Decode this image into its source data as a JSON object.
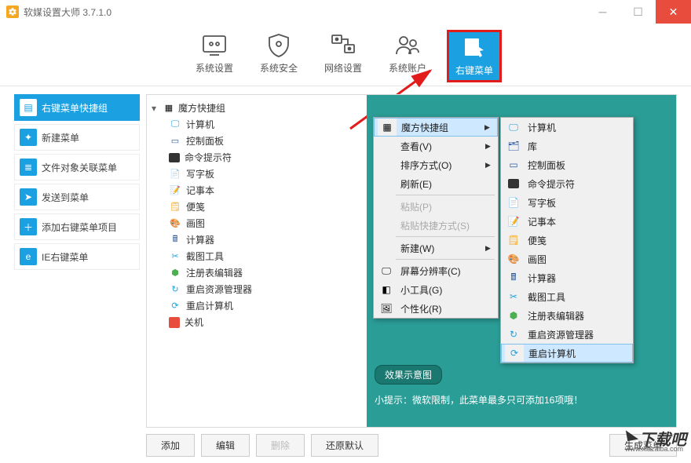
{
  "app": {
    "title": "软媒设置大师 3.7.1.0"
  },
  "tabs": {
    "items": [
      {
        "label": "系统设置"
      },
      {
        "label": "系统安全"
      },
      {
        "label": "网络设置"
      },
      {
        "label": "系统账户"
      },
      {
        "label": "右键菜单"
      }
    ]
  },
  "sidebar": {
    "items": [
      {
        "label": "右键菜单快捷组"
      },
      {
        "label": "新建菜单"
      },
      {
        "label": "文件对象关联菜单"
      },
      {
        "label": "发送到菜单"
      },
      {
        "label": "添加右键菜单项目"
      },
      {
        "label": "IE右键菜单"
      }
    ]
  },
  "tree": {
    "root": "魔方快捷组",
    "items": [
      {
        "label": "计算机"
      },
      {
        "label": "控制面板"
      },
      {
        "label": "命令提示符"
      },
      {
        "label": "写字板"
      },
      {
        "label": "记事本"
      },
      {
        "label": "便笺"
      },
      {
        "label": "画图"
      },
      {
        "label": "计算器"
      },
      {
        "label": "截图工具"
      },
      {
        "label": "注册表编辑器"
      },
      {
        "label": "重启资源管理器"
      },
      {
        "label": "重启计算机"
      },
      {
        "label": "关机"
      }
    ]
  },
  "context": {
    "items": [
      {
        "label": "魔方快捷组",
        "arrow": true,
        "hl": true
      },
      {
        "label": "查看(V)",
        "arrow": true
      },
      {
        "label": "排序方式(O)",
        "arrow": true
      },
      {
        "label": "刷新(E)"
      },
      {
        "sep": true
      },
      {
        "label": "粘贴(P)",
        "disabled": true
      },
      {
        "label": "粘贴快捷方式(S)",
        "disabled": true
      },
      {
        "sep": true
      },
      {
        "label": "新建(W)",
        "arrow": true
      },
      {
        "sep": true
      },
      {
        "label": "屏幕分辨率(C)",
        "icon": true
      },
      {
        "label": "小工具(G)",
        "icon": true
      },
      {
        "label": "个性化(R)",
        "icon": true
      }
    ]
  },
  "submenu": {
    "items": [
      {
        "label": "计算机"
      },
      {
        "label": "库"
      },
      {
        "label": "控制面板"
      },
      {
        "label": "命令提示符"
      },
      {
        "label": "写字板"
      },
      {
        "label": "记事本"
      },
      {
        "label": "便笺"
      },
      {
        "label": "画图"
      },
      {
        "label": "计算器"
      },
      {
        "label": "截图工具"
      },
      {
        "label": "注册表编辑器"
      },
      {
        "label": "重启资源管理器"
      },
      {
        "label": "重启计算机",
        "hl": true
      }
    ]
  },
  "preview": {
    "badge": "效果示意图",
    "tip": "小提示：微软限制，此菜单最多只可添加16项哦！"
  },
  "buttons": {
    "add": "添加",
    "edit": "编辑",
    "delete": "删除",
    "restore": "还原默认",
    "generate": "生成菜单"
  },
  "watermark": "下载吧",
  "watermark_url": "www.xiazaiba.com"
}
